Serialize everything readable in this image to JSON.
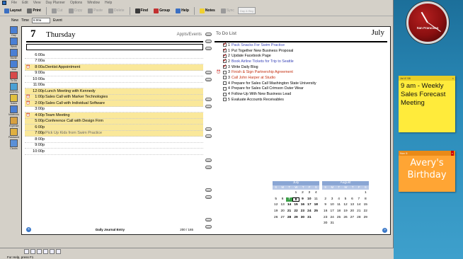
{
  "menu": [
    "File",
    "Edit",
    "View",
    "Day Planner",
    "Options",
    "Window",
    "Help"
  ],
  "toolbar": {
    "buttons": [
      {
        "label": "Layout",
        "icon": "layout-icon",
        "color": "#3b6fc2",
        "dim": false
      },
      {
        "label": "Print",
        "icon": "print-icon",
        "color": "#6a6a6a",
        "dim": false
      },
      {
        "label": "Cut",
        "icon": "cut-icon",
        "color": "#9a9a9a",
        "dim": true
      },
      {
        "label": "Copy",
        "icon": "copy-icon",
        "color": "#9a9a9a",
        "dim": true
      },
      {
        "label": "Paste",
        "icon": "paste-icon",
        "color": "#9a9a9a",
        "dim": true
      },
      {
        "label": "Delete",
        "icon": "delete-icon",
        "color": "#9a9a9a",
        "dim": true
      },
      {
        "label": "Find",
        "icon": "find-icon",
        "color": "#3a3a3a",
        "dim": false
      },
      {
        "label": "Group",
        "icon": "group-icon",
        "color": "#c23030",
        "dim": false
      },
      {
        "label": "Help",
        "icon": "help-icon",
        "color": "#3b6fc2",
        "dim": false
      },
      {
        "label": "Notes",
        "icon": "notes-icon",
        "color": "#f0d030",
        "dim": false
      },
      {
        "label": "Sync",
        "icon": "sync-icon",
        "color": "#9a9a9a",
        "dim": true
      }
    ],
    "box_label": "Day & Bkg"
  },
  "toolbar2": {
    "new_label": "New",
    "time_label": "Time",
    "time_value": "6:00a",
    "event_label": "Event"
  },
  "sidebar": [
    "Day",
    "Week",
    "Month",
    "Year",
    "To Do",
    "Address",
    "Notes",
    "Notebook",
    "Expense",
    "Password",
    "Clocks"
  ],
  "day": {
    "number": "7",
    "name": "Thursday",
    "appts_label": "Appts/Events",
    "slots": [
      {
        "time": "6:00a",
        "text": "",
        "hl": false,
        "bell": false,
        "color": ""
      },
      {
        "time": "7:00a",
        "text": "",
        "hl": false,
        "bell": false,
        "color": ""
      },
      {
        "time": "8:00a",
        "text": "Dentist Appointment",
        "hl": true,
        "bell": true,
        "color": ""
      },
      {
        "time": "9:00a",
        "text": "",
        "hl": false,
        "bell": false,
        "color": ""
      },
      {
        "time": "10:00a",
        "text": "",
        "hl": false,
        "bell": false,
        "color": ""
      },
      {
        "time": "11:00a",
        "text": "",
        "hl": false,
        "bell": false,
        "color": ""
      },
      {
        "time": "12:00p",
        "text": "Lunch Meeting with Kennedy",
        "hl": true,
        "bell": false,
        "color": ""
      },
      {
        "time": "1:00p",
        "text": "Sales Call with Marker Technologies",
        "hl": true,
        "bell": true,
        "color": ""
      },
      {
        "time": "2:00p",
        "text": "Sales Call with Individual Software",
        "hl": true,
        "bell": true,
        "color": ""
      },
      {
        "time": "3:00p",
        "text": "",
        "hl": false,
        "bell": false,
        "color": ""
      },
      {
        "time": "4:00p",
        "text": "Team Meeting",
        "hl": true,
        "bell": true,
        "color": ""
      },
      {
        "time": "5:00p",
        "text": "Conference Call with Design Firm",
        "hl": true,
        "bell": false,
        "color": ""
      },
      {
        "time": "6:00p",
        "text": "",
        "hl": true,
        "bell": false,
        "color": ""
      },
      {
        "time": "7:00p",
        "text": "Pick Up Kids from Swim Practice",
        "hl": true,
        "bell": false,
        "color": "#6a6a6a"
      },
      {
        "time": "8:00p",
        "text": "",
        "hl": false,
        "bell": false,
        "color": ""
      },
      {
        "time": "9:00p",
        "text": "",
        "hl": false,
        "bell": false,
        "color": ""
      },
      {
        "time": "10:00p",
        "text": "",
        "hl": false,
        "bell": false,
        "color": ""
      }
    ],
    "journal_label": "Daily Journal Entry",
    "page_label": "200 / 165"
  },
  "todo": {
    "label": "To Do List",
    "month": "July",
    "items": [
      {
        "done": true,
        "priority": "1",
        "text": "Pack Snacks For Swim Practice",
        "style": "done",
        "mark": false
      },
      {
        "done": true,
        "priority": "1",
        "text": "Put Together New Business Proposal",
        "style": "",
        "mark": false
      },
      {
        "done": true,
        "priority": "2",
        "text": "Update Facebook Page",
        "style": "",
        "mark": false
      },
      {
        "done": true,
        "priority": "2",
        "text": "Book Airline Tickets for Trip to Seattle",
        "style": "done",
        "mark": false
      },
      {
        "done": true,
        "priority": "3",
        "text": "Write Daily Blog",
        "style": "",
        "mark": false
      },
      {
        "done": false,
        "priority": "3",
        "text": "Finish & Sign Partnership Agreement",
        "style": "red",
        "mark": true
      },
      {
        "done": false,
        "priority": "3",
        "text": "Call John Harper at Studio",
        "style": "red",
        "mark": false
      },
      {
        "done": false,
        "priority": "4",
        "text": "Prepare for Sales Call Washington State University",
        "style": "",
        "mark": false
      },
      {
        "done": false,
        "priority": "4",
        "text": "Prepare for Sales Call Crimson Outer Wear",
        "style": "",
        "mark": false
      },
      {
        "done": false,
        "priority": "4",
        "text": "Follow-Up With New Business Lead",
        "style": "",
        "mark": false
      },
      {
        "done": false,
        "priority": "5",
        "text": "Evaluate Accounts Receivables",
        "style": "",
        "mark": false
      }
    ]
  },
  "calendars": [
    {
      "title": "July",
      "dows": [
        "S",
        "M",
        "T",
        "W",
        "T",
        "F",
        "S"
      ],
      "days": [
        "",
        "",
        "",
        "1",
        "2",
        "3",
        "4",
        "5",
        "6",
        "7",
        "8",
        "9",
        "10",
        "11",
        "12",
        "13",
        "14",
        "15",
        "16",
        "17",
        "18",
        "19",
        "20",
        "21",
        "22",
        "23",
        "24",
        "25",
        "26",
        "27",
        "28",
        "29",
        "30",
        "31",
        ""
      ],
      "today": "7",
      "selected": "8"
    },
    {
      "title": "August",
      "dows": [
        "S",
        "M",
        "T",
        "W",
        "T",
        "F",
        "S"
      ],
      "days": [
        "",
        "",
        "",
        "",
        "",
        "",
        "1",
        "2",
        "3",
        "4",
        "5",
        "6",
        "7",
        "8",
        "9",
        "10",
        "11",
        "12",
        "13",
        "14",
        "15",
        "16",
        "17",
        "18",
        "19",
        "20",
        "21",
        "22",
        "23",
        "24",
        "25",
        "26",
        "27",
        "28",
        "29",
        "30",
        "31"
      ],
      "today": "",
      "selected": ""
    }
  ],
  "status": {
    "text": "For Help, press F1"
  },
  "gadgets": {
    "clock_label": "San Francisco",
    "note1": {
      "date": "Jul 8 '08",
      "text": "9 am - Weekly Sales Forecast Meeting"
    },
    "note2": {
      "date": "Nov 5",
      "text": "Avery's Birthday"
    }
  }
}
